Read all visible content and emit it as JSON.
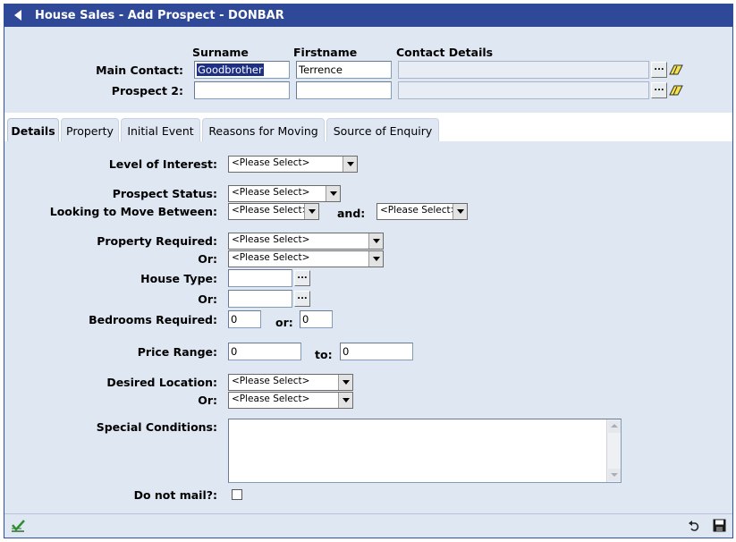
{
  "window": {
    "title": "House Sales - Add Prospect - DONBAR",
    "back_icon": "back-arrow-icon"
  },
  "contacts": {
    "col_surname": "Surname",
    "col_firstname": "Firstname",
    "col_contact_details": "Contact Details",
    "main_label": "Main Contact:",
    "main_surname": "Goodbrother",
    "main_firstname": "Terrence",
    "main_details": "",
    "p2_label": "Prospect 2:",
    "p2_surname": "",
    "p2_firstname": "",
    "p2_details": "",
    "lookup_button": "...",
    "clear_icon": "eraser-icon"
  },
  "tabs": [
    {
      "label": "Details",
      "active": true
    },
    {
      "label": "Property",
      "active": false
    },
    {
      "label": "Initial Event",
      "active": false
    },
    {
      "label": "Reasons for Moving",
      "active": false
    },
    {
      "label": "Source of Enquiry",
      "active": false
    }
  ],
  "form": {
    "placeholder": "<Please Select>",
    "level_of_interest_label": "Level of Interest:",
    "prospect_status_label": "Prospect Status:",
    "looking_to_move_label": "Looking to Move Between:",
    "and_label": "and:",
    "property_required_label": "Property Required:",
    "or_label": "Or:",
    "house_type_label": "House Type:",
    "house_type_value": "",
    "house_type_or_value": "",
    "bedrooms_label": "Bedrooms Required:",
    "bedrooms_min": "0",
    "bedrooms_or_label": "or:",
    "bedrooms_max": "0",
    "price_range_label": "Price Range:",
    "price_min": "0",
    "price_to_label": "to:",
    "price_max": "0",
    "desired_location_label": "Desired Location:",
    "special_conditions_label": "Special Conditions:",
    "special_conditions_value": "",
    "do_not_mail_label": "Do not mail?:",
    "do_not_mail_checked": false
  },
  "footer": {
    "confirm_icon": "checkmark-icon",
    "undo_icon": "undo-icon",
    "save_icon": "save-disk-icon"
  },
  "colors": {
    "title_bar": "#2f4897",
    "panel": "#dfe7f3",
    "selected_text": "#1e2f86"
  }
}
